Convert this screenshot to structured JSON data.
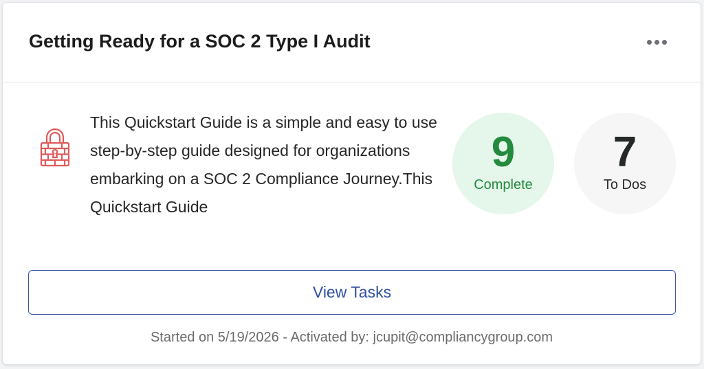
{
  "card": {
    "title": "Getting Ready for a SOC 2 Type I Audit",
    "menu_icon": "more-horizontal-icon",
    "lock_icon": "padlock-icon",
    "description": "This Quickstart Guide is a simple and easy to use step-by-step guide designed for organizations embarking on a SOC 2 Compliance Journey.This Quickstart Guide",
    "stats": {
      "complete": {
        "value": "9",
        "label": "Complete"
      },
      "todos": {
        "value": "7",
        "label": "To Dos"
      }
    },
    "view_tasks_label": "View Tasks",
    "footer": "Started on 5/19/2026 - Activated by: jcupit@compliancygroup.com"
  },
  "colors": {
    "complete_green": "#238a3e",
    "complete_bg": "#e5f6ea",
    "todos_bg": "#f6f6f6",
    "button_blue": "#2f4fa0",
    "lock_red": "#e05a5a"
  }
}
